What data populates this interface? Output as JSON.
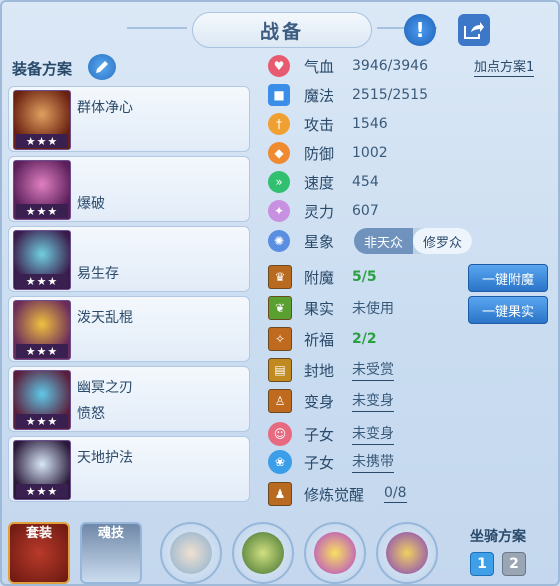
{
  "window": {
    "title": "战备"
  },
  "equip_section": {
    "label": "装备方案",
    "items": [
      {
        "name": "群体净心",
        "sub": "",
        "stars": "★★★"
      },
      {
        "name": "爆破",
        "sub": "",
        "stars": "★★★"
      },
      {
        "name": "易生存",
        "sub": "",
        "stars": "★★★"
      },
      {
        "name": "泼天乱棍",
        "sub": "",
        "stars": "★★★"
      },
      {
        "name": "幽冥之刃",
        "sub": "愤怒",
        "stars": "★★★"
      },
      {
        "name": "天地护法",
        "sub": "",
        "stars": "★★★"
      }
    ]
  },
  "stats": {
    "plan_button": "加点方案1",
    "rows": [
      {
        "label": "气血",
        "value": "3946/3946",
        "icon": "heart-icon",
        "color": "#e85a70"
      },
      {
        "label": "魔法",
        "value": "2515/2515",
        "icon": "mana-icon",
        "color": "#3a8ee8"
      },
      {
        "label": "攻击",
        "value": "1546",
        "icon": "attack-icon",
        "color": "#f0a030"
      },
      {
        "label": "防御",
        "value": "1002",
        "icon": "defense-icon",
        "color": "#f08a30"
      },
      {
        "label": "速度",
        "value": "454",
        "icon": "speed-icon",
        "color": "#30c070"
      },
      {
        "label": "灵力",
        "value": "607",
        "icon": "spirit-icon",
        "color": "#c890e0"
      }
    ],
    "star_label": "星象",
    "star_toggle": {
      "off": "非天众",
      "on": "修罗众"
    }
  },
  "extras": {
    "rows": [
      {
        "label": "附魔",
        "value": "5/5",
        "style": "green"
      },
      {
        "label": "果实",
        "value": "未使用",
        "style": ""
      },
      {
        "label": "祈福",
        "value": "2/2",
        "style": "green"
      },
      {
        "label": "封地",
        "value": "未受赏",
        "style": "ul"
      },
      {
        "label": "变身",
        "value": "未变身",
        "style": "ul"
      },
      {
        "label": "子女",
        "value": "未变身",
        "style": "ul"
      },
      {
        "label": "子女",
        "value": "未携带",
        "style": "ul"
      },
      {
        "label": "修炼觉醒",
        "value": "0/8",
        "style": "ul"
      }
    ],
    "btn_enchant": "一键附魔",
    "btn_fruit": "一键果实"
  },
  "bottom": {
    "set_label": "套装",
    "soul_label": "魂技",
    "mount_label": "坐骑方案",
    "mount_1": "1",
    "mount_2": "2"
  }
}
